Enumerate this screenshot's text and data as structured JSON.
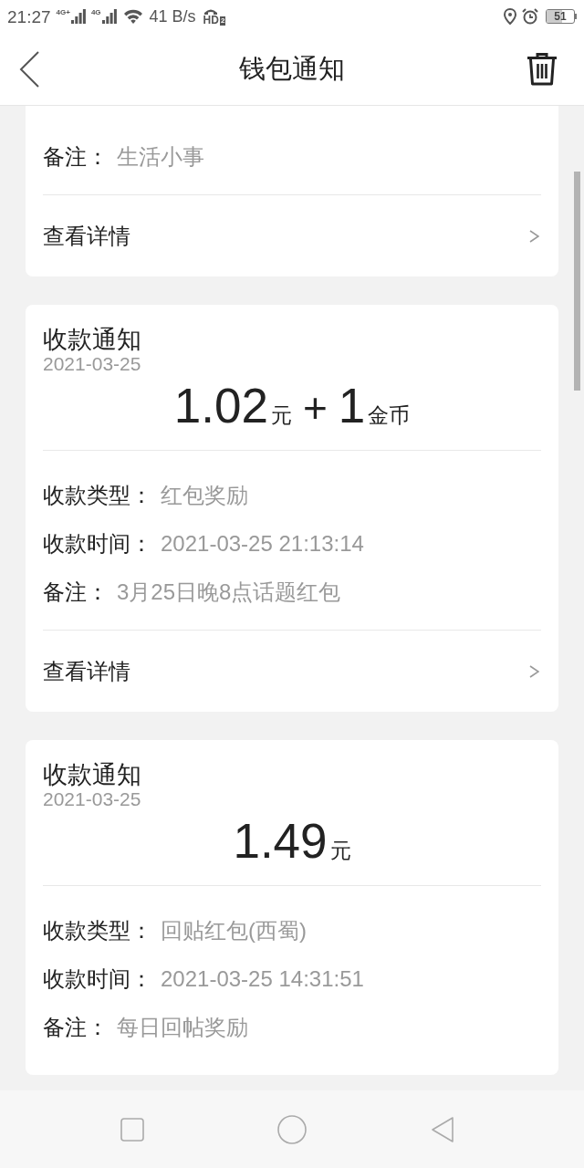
{
  "status_bar": {
    "time": "21:27",
    "network_labels": [
      "4G+",
      "4G"
    ],
    "speed": "41 B/s",
    "hd_label": "HD",
    "hd_slot": "2",
    "battery": "51"
  },
  "header": {
    "title": "钱包通知"
  },
  "notices": [
    {
      "rows": [
        {
          "label": "备注：",
          "value": "生活小事"
        }
      ],
      "details_link": "查看详情"
    },
    {
      "title": "收款通知",
      "date": "2021-03-25",
      "amounts": [
        {
          "value": "1.02",
          "unit": "元"
        },
        {
          "value": "1",
          "unit": "金币"
        }
      ],
      "amount_separator": "+",
      "rows": [
        {
          "label": "收款类型：",
          "value": "红包奖励"
        },
        {
          "label": "收款时间：",
          "value": "2021-03-25 21:13:14"
        },
        {
          "label": "备注：",
          "value": "3月25日晚8点话题红包"
        }
      ],
      "details_link": "查看详情"
    },
    {
      "title": "收款通知",
      "date": "2021-03-25",
      "amounts": [
        {
          "value": "1.49",
          "unit": "元"
        }
      ],
      "rows": [
        {
          "label": "收款类型：",
          "value": "回贴红包(西蜀)"
        },
        {
          "label": "收款时间：",
          "value": "2021-03-25 14:31:51"
        },
        {
          "label": "备注：",
          "value": "每日回帖奖励"
        }
      ]
    }
  ]
}
